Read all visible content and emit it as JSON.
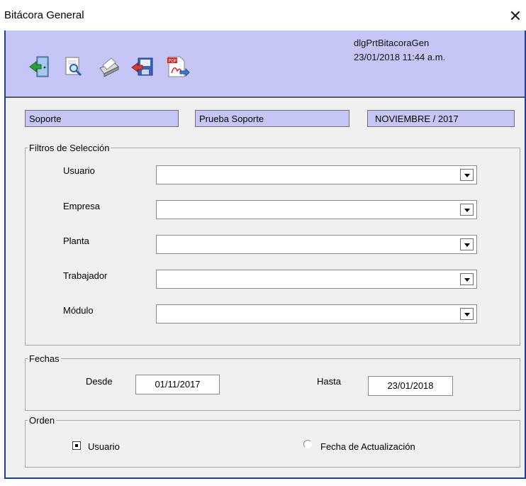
{
  "window": {
    "title": "Bitácora General",
    "close_glyph": "✕"
  },
  "toolbar": {
    "buttons": [
      {
        "name": "exit-icon"
      },
      {
        "name": "preview-icon"
      },
      {
        "name": "print-icon"
      },
      {
        "name": "export-icon"
      },
      {
        "name": "pdf-icon"
      }
    ],
    "dialog_id": "dlgPrtBitacoraGen",
    "timestamp": "23/01/2018 11:44 a.m.",
    "pdf_badge": "PDF"
  },
  "info": {
    "area": "Soporte",
    "company": "Prueba Soporte",
    "period": "NOVIEMBRE / 2017"
  },
  "filters": {
    "legend": "Filtros de Selección",
    "fields": [
      {
        "label": "Usuario",
        "value": ""
      },
      {
        "label": "Empresa",
        "value": ""
      },
      {
        "label": "Planta",
        "value": ""
      },
      {
        "label": "Trabajador",
        "value": ""
      },
      {
        "label": "Módulo",
        "value": ""
      }
    ]
  },
  "dates": {
    "legend": "Fechas",
    "from_label": "Desde",
    "from_value": "01/11/2017",
    "to_label": "Hasta",
    "to_value": "23/01/2018"
  },
  "order": {
    "legend": "Orden",
    "options": [
      {
        "label": "Usuario",
        "selected": true
      },
      {
        "label": "Fecha de Actualización",
        "selected": false
      }
    ]
  },
  "colors": {
    "header_bg": "#c5c6f6",
    "frame_border": "#1f3f99",
    "panel_bg": "#f0f0f0"
  }
}
